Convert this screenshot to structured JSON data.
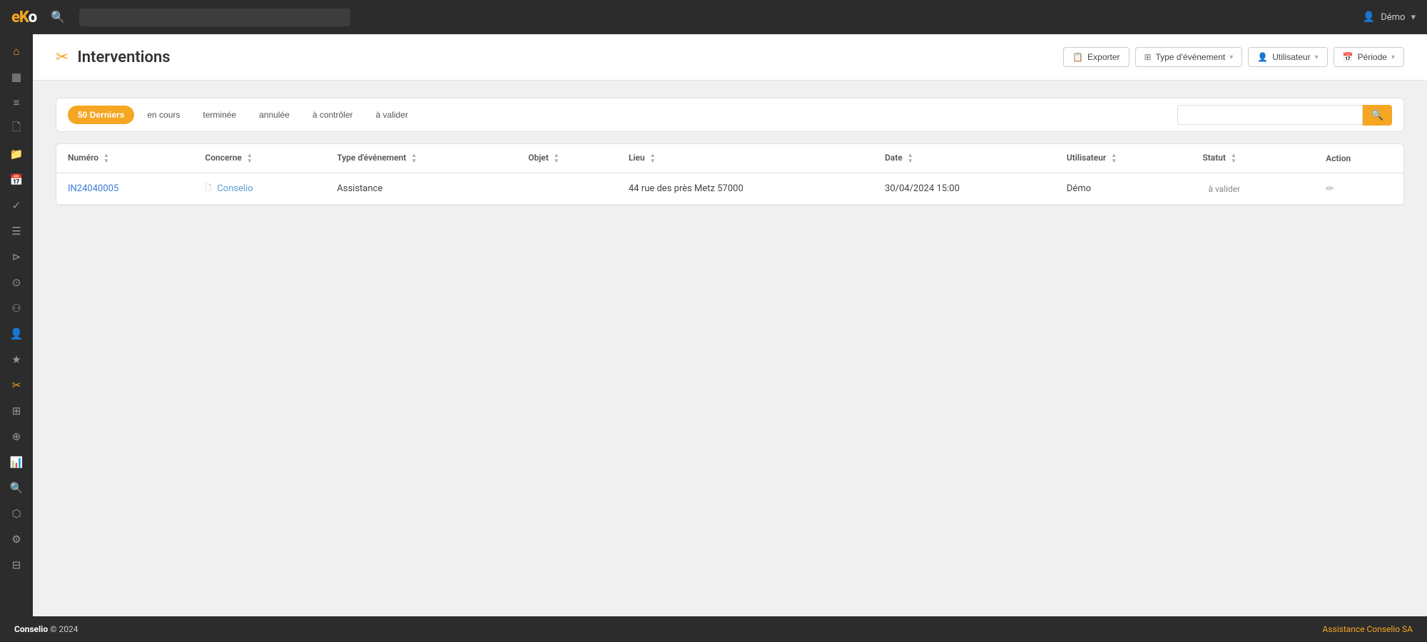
{
  "app": {
    "logo": "eKo",
    "logo_color": "eK",
    "logo_o": "o"
  },
  "topnav": {
    "search_placeholder": "",
    "user_label": "Démo",
    "user_chevron": "▾"
  },
  "sidebar": {
    "items": [
      {
        "id": "home",
        "icon": "⌂"
      },
      {
        "id": "dashboard",
        "icon": "▦"
      },
      {
        "id": "list",
        "icon": "≡"
      },
      {
        "id": "document",
        "icon": "📄"
      },
      {
        "id": "folder",
        "icon": "📁"
      },
      {
        "id": "calendar",
        "icon": "📅"
      },
      {
        "id": "check",
        "icon": "✓"
      },
      {
        "id": "lines",
        "icon": "☰"
      },
      {
        "id": "truck",
        "icon": "🚚"
      },
      {
        "id": "badge",
        "icon": "🏷"
      },
      {
        "id": "group",
        "icon": "👥"
      },
      {
        "id": "person",
        "icon": "👤"
      },
      {
        "id": "star",
        "icon": "✦"
      },
      {
        "id": "tool",
        "icon": "✂"
      },
      {
        "id": "report",
        "icon": "📊"
      },
      {
        "id": "globe",
        "icon": "🌐"
      },
      {
        "id": "chart",
        "icon": "📈"
      },
      {
        "id": "search",
        "icon": "🔍"
      },
      {
        "id": "network",
        "icon": "⬡"
      },
      {
        "id": "settings",
        "icon": "⚙"
      },
      {
        "id": "table2",
        "icon": "⊞"
      }
    ]
  },
  "page": {
    "title": "Interventions",
    "icon": "✂"
  },
  "header_actions": {
    "export_label": "Exporter",
    "export_icon": "📋",
    "event_type_label": "Type d'événement",
    "user_label": "Utilisateur",
    "period_label": "Période"
  },
  "filters": {
    "tabs": [
      {
        "id": "50derniers",
        "label": "50 Derniers",
        "active": true
      },
      {
        "id": "encours",
        "label": "en cours",
        "active": false
      },
      {
        "id": "terminee",
        "label": "terminée",
        "active": false
      },
      {
        "id": "annulee",
        "label": "annulée",
        "active": false
      },
      {
        "id": "acontroler",
        "label": "à contrôler",
        "active": false
      },
      {
        "id": "avalider",
        "label": "à valider",
        "active": false
      }
    ],
    "search_placeholder": ""
  },
  "table": {
    "columns": [
      {
        "id": "numero",
        "label": "Numéro"
      },
      {
        "id": "concerne",
        "label": "Concerne"
      },
      {
        "id": "type_evenement",
        "label": "Type d'événement"
      },
      {
        "id": "objet",
        "label": "Objet"
      },
      {
        "id": "lieu",
        "label": "Lieu"
      },
      {
        "id": "date",
        "label": "Date"
      },
      {
        "id": "utilisateur",
        "label": "Utilisateur"
      },
      {
        "id": "statut",
        "label": "Statut"
      },
      {
        "id": "action",
        "label": "Action"
      }
    ],
    "rows": [
      {
        "numero": "IN24040005",
        "concerne": "Conselio",
        "type_evenement": "Assistance",
        "objet": "",
        "lieu": "44 rue des près Metz 57000",
        "date": "30/04/2024 15:00",
        "utilisateur": "Démo",
        "statut": "à valider",
        "action": "edit"
      }
    ]
  },
  "footer": {
    "company": "Conselio",
    "year": "© 2024",
    "right_text": "Assistance Conselio SA"
  }
}
